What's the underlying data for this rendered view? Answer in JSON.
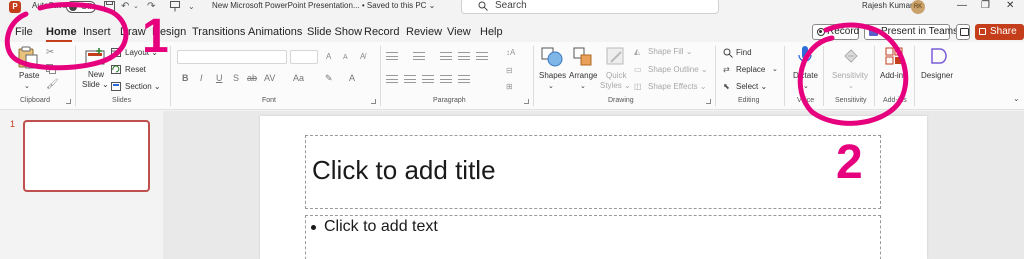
{
  "titlebar": {
    "autosave_label": "AutoSave",
    "autosave_state": "Off",
    "document_title": "New Microsoft PowerPoint Presentation...  •  Saved to this PC ⌄",
    "search_placeholder": "Search",
    "user_name": "Rajesh Kumar",
    "user_initials": "RK"
  },
  "tabs": [
    "File",
    "Home",
    "Insert",
    "Draw",
    "Design",
    "Transitions",
    "Animations",
    "Slide Show",
    "Record",
    "Review",
    "View",
    "Help"
  ],
  "active_tab": "Home",
  "actions": {
    "record": "Record",
    "present_teams": "Present in Teams",
    "share": "Share ⌄"
  },
  "ribbon": {
    "clipboard": {
      "label": "Clipboard",
      "paste": "Paste"
    },
    "slides": {
      "label": "Slides",
      "new_slide": "New",
      "new_slide_line2": "Slide ⌄",
      "layout": "Layout ⌄",
      "reset": "Reset",
      "section": "Section ⌄"
    },
    "font": {
      "label": "Font",
      "bold": "B",
      "italic": "I",
      "underline": "U",
      "strike": "S",
      "abc": "ab",
      "spacing": "AV",
      "case": "Aa",
      "grow": "A",
      "shrink": "A"
    },
    "paragraph": {
      "label": "Paragraph"
    },
    "drawing": {
      "label": "Drawing",
      "shapes": "Shapes",
      "arrange": "Arrange",
      "quick_styles": "Quick",
      "quick_styles_line2": "Styles ⌄",
      "shape_fill": "Shape Fill ⌄",
      "shape_outline": "Shape Outline ⌄",
      "shape_effects": "Shape Effects ⌄"
    },
    "editing": {
      "label": "Editing",
      "find": "Find",
      "replace": "Replace",
      "select": "Select ⌄"
    },
    "voice": {
      "label": "Voice",
      "dictate": "Dictate"
    },
    "sensitivity": {
      "label": "Sensitivity",
      "button": "Sensitivity"
    },
    "addins": {
      "label": "Add-ins",
      "button": "Add-ins"
    },
    "designer": {
      "button": "Designer"
    }
  },
  "slide_panel": {
    "current_slide": "1"
  },
  "slide": {
    "title_placeholder": "Click to add title",
    "body_placeholder": "Click to add text"
  },
  "annotations": {
    "marker_1": "1",
    "marker_2": "2",
    "color": "#e6007e"
  },
  "colors": {
    "accent": "#c43e1c",
    "thumb_border": "#c0504d",
    "dictate_blue": "#2b6cd9"
  }
}
